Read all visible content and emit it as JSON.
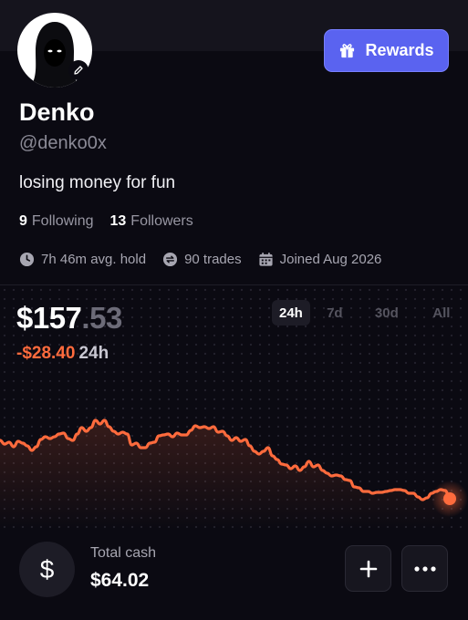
{
  "profile": {
    "name": "Denko",
    "handle": "@denko0x",
    "bio": "losing money for fun",
    "following_count": "9",
    "following_label": "Following",
    "followers_count": "13",
    "followers_label": "Followers"
  },
  "header": {
    "rewards_label": "Rewards",
    "accent_color": "#5a63f0"
  },
  "stats": {
    "avg_hold": "7h 46m avg. hold",
    "trades": "90 trades",
    "joined": "Joined Aug 2026",
    "icons": [
      "clock-icon",
      "swap-icon",
      "calendar-icon"
    ]
  },
  "portfolio": {
    "balance_whole": "$157",
    "balance_cents": ".53",
    "change": "-$28.40",
    "change_period": "24h",
    "change_color": "#ff6b3d",
    "tabs": [
      "24h",
      "7d",
      "30d",
      "All"
    ],
    "active_tab": "24h"
  },
  "chart_data": {
    "type": "line",
    "title": "",
    "xlabel": "",
    "ylabel": "",
    "line_color": "#ff6b3d",
    "values": [
      63,
      67,
      65,
      70,
      64,
      66,
      69,
      74,
      70,
      62,
      59,
      61,
      59,
      56,
      55,
      61,
      63,
      56,
      49,
      53,
      49,
      41,
      45,
      41,
      48,
      53,
      56,
      54,
      56,
      68,
      66,
      71,
      71,
      66,
      65,
      58,
      57,
      56,
      59,
      55,
      57,
      57,
      52,
      47,
      49,
      48,
      50,
      48,
      54,
      53,
      58,
      63,
      60,
      64,
      62,
      69,
      75,
      78,
      75,
      71,
      80,
      84,
      89,
      90,
      94,
      91,
      96,
      92,
      86,
      92,
      90,
      96,
      99,
      102,
      101,
      102,
      106,
      107,
      114,
      115,
      119,
      119,
      121,
      120,
      120,
      119,
      118,
      117,
      117,
      118,
      121,
      121,
      125,
      128,
      126,
      121,
      119,
      117,
      118,
      127
    ]
  },
  "cash": {
    "label": "Total cash",
    "value": "$64.02",
    "icon": "dollar-icon"
  },
  "actions": {
    "add_icon": "plus-icon",
    "more_icon": "more-icon"
  }
}
